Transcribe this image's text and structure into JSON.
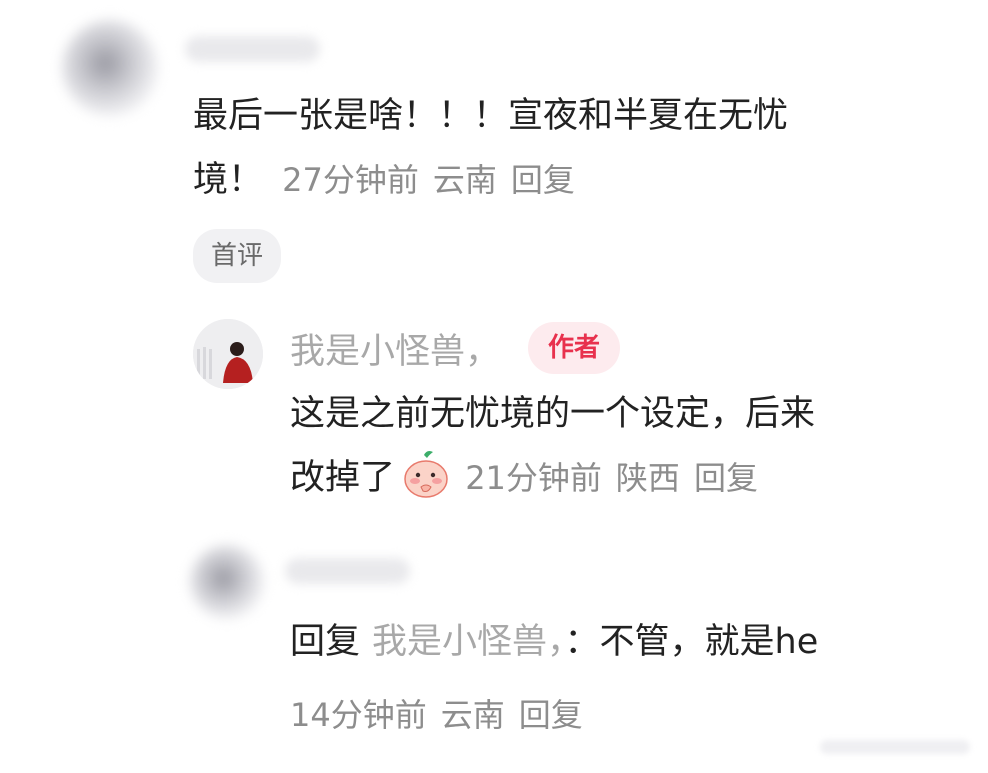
{
  "comment1": {
    "text_line1": "最后一张是啥！！！宣夜和半夏在无忧",
    "text_line2": "境！",
    "time": "27分钟前",
    "location": "云南",
    "reply": "回复",
    "badge": "首评"
  },
  "reply1": {
    "username": "我是小怪兽，",
    "author_badge": "作者",
    "text_line1": "这是之前无忧境的一个设定，后来",
    "text_line2": "改掉了",
    "emoji": "blush-bun-emoji",
    "time": "21分钟前",
    "location": "陕西",
    "reply": "回复"
  },
  "reply2": {
    "prefix": "回复",
    "mention": "我是小怪兽，",
    "colon": "：",
    "text": "不管，就是he",
    "time": "14分钟前",
    "location": "云南",
    "reply": "回复"
  },
  "colors": {
    "author_badge_text": "#e8314d",
    "author_badge_bg": "#fdebee",
    "meta": "#8d8d8d",
    "text": "#222222"
  }
}
